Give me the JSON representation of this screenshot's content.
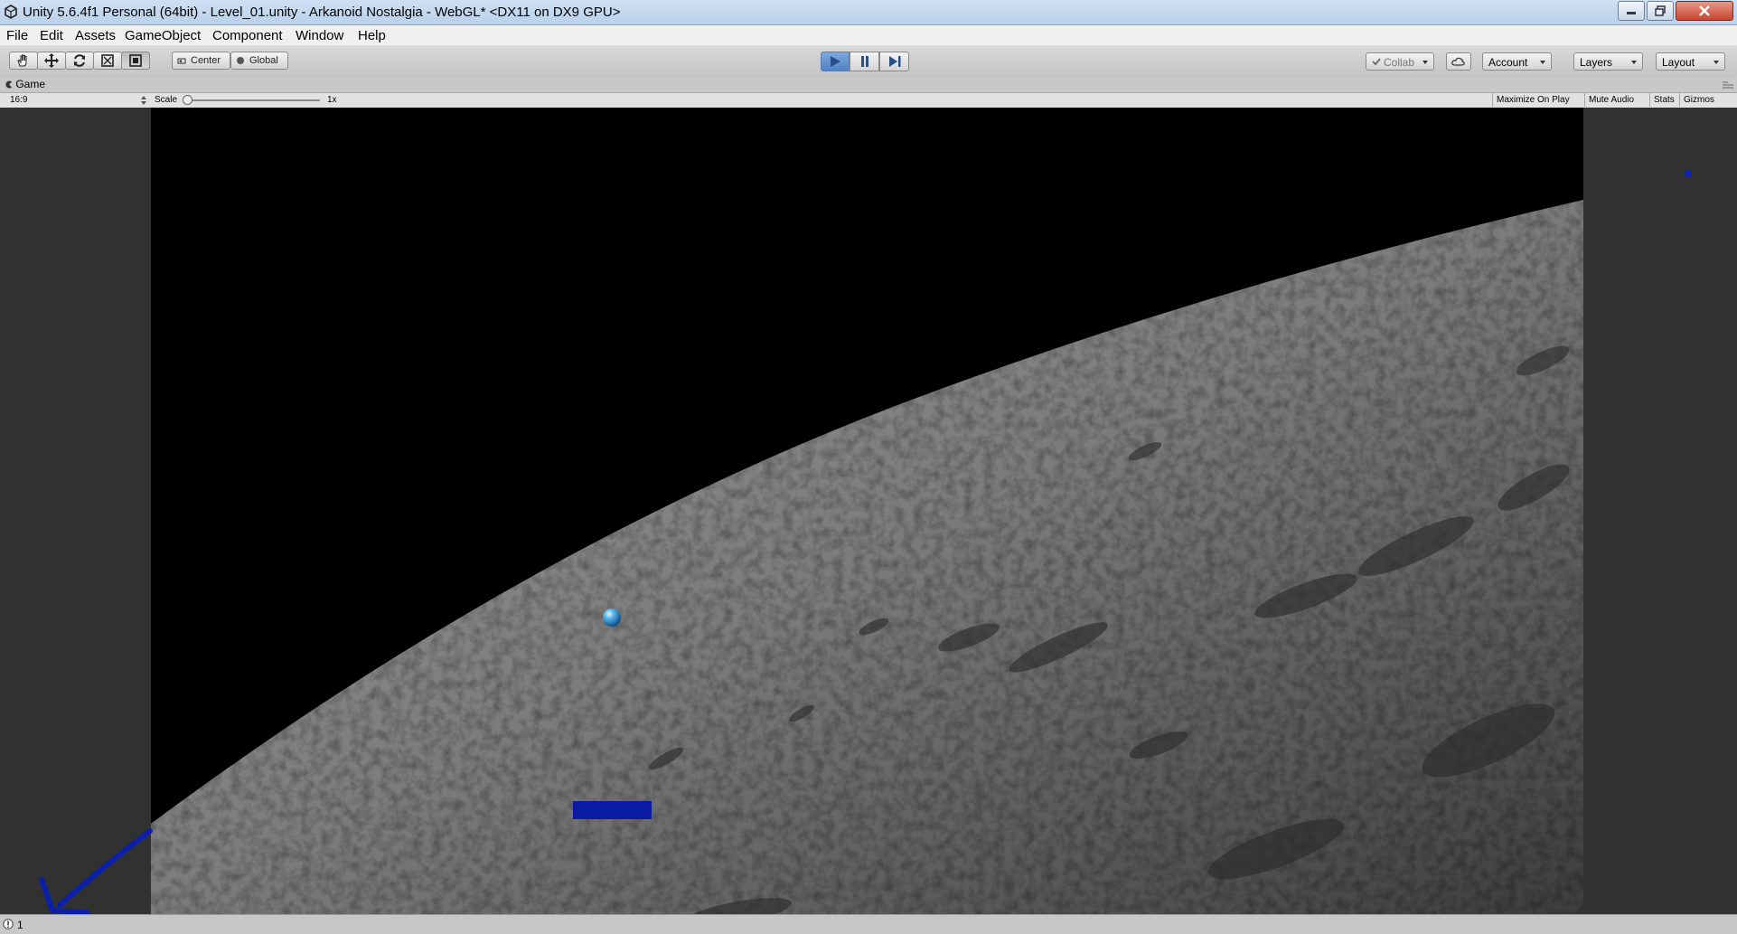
{
  "window": {
    "title": "Unity 5.6.4f1 Personal (64bit) - Level_01.unity - Arkanoid Nostalgia - WebGL* <DX11 on DX9 GPU>"
  },
  "menu": [
    "File",
    "Edit",
    "Assets",
    "GameObject",
    "Component",
    "Window",
    "Help"
  ],
  "toolbar": {
    "pivot_label": "Center",
    "space_label": "Global",
    "collab_label": "Collab",
    "account_label": "Account",
    "layers_label": "Layers",
    "layout_label": "Layout"
  },
  "game_tab": {
    "title": "Game",
    "aspect": "16:9",
    "scale_label": "Scale",
    "scale_value": "1x",
    "maximize_label": "Maximize On Play",
    "mute_label": "Mute Audio",
    "stats_label": "Stats",
    "gizmos_label": "Gizmos"
  },
  "status": {
    "count": "1"
  },
  "colors": {
    "paddle": "#0a1aa3",
    "ball": "#1e90d8",
    "annotation_arrow": "#0b1fa8",
    "play_button": "#5a8bd0"
  }
}
